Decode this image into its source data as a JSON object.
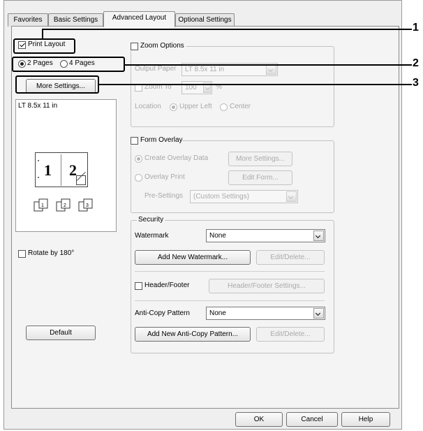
{
  "tabs": [
    "Favorites",
    "Basic Settings",
    "Advanced Layout",
    "Optional Settings"
  ],
  "print_layout": {
    "label": "Print Layout",
    "checked": true
  },
  "pages": {
    "option1": "2 Pages",
    "option2": "4 Pages",
    "selected": "2 Pages"
  },
  "more_settings_left": "More Settings...",
  "preview": {
    "paper": "LT 8.5x 11 in",
    "page1": "1",
    "page2": "2"
  },
  "rotate": {
    "label": "Rotate by 180°",
    "checked": false
  },
  "default_button": "Default",
  "zoom": {
    "label": "Zoom Options",
    "output_paper_label": "Output Paper",
    "output_paper_value": "LT 8.5x 11 in",
    "zoom_to_label": "Zoom To",
    "zoom_to_value": "100",
    "zoom_unit": "%",
    "location_label": "Location",
    "upper_left": "Upper Left",
    "center": "Center"
  },
  "form_overlay": {
    "label": "Form Overlay",
    "create": "Create Overlay Data",
    "more_settings": "More Settings...",
    "overlay_print": "Overlay Print",
    "edit_form": "Edit Form...",
    "pre_settings_label": "Pre-Settings",
    "pre_settings_value": "(Custom Settings)"
  },
  "security": {
    "legend": "Security",
    "watermark_label": "Watermark",
    "watermark_value": "None",
    "add_watermark": "Add New Watermark...",
    "edit_delete_1": "Edit/Delete...",
    "header_footer_label": "Header/Footer",
    "header_footer_settings": "Header/Footer Settings...",
    "anticopy_label": "Anti-Copy Pattern",
    "anticopy_value": "None",
    "add_anticopy": "Add New Anti-Copy Pattern...",
    "edit_delete_2": "Edit/Delete..."
  },
  "footer": {
    "ok": "OK",
    "cancel": "Cancel",
    "help": "Help"
  },
  "callouts": [
    "1",
    "2",
    "3"
  ]
}
